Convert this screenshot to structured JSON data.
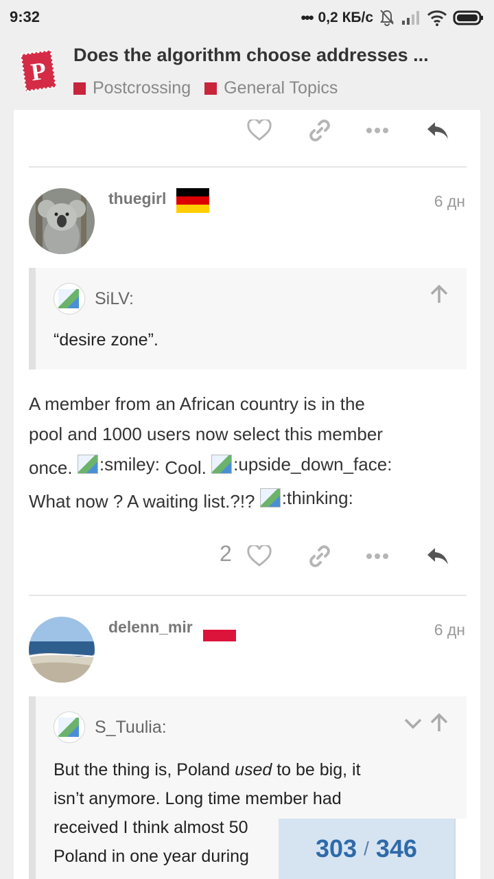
{
  "status": {
    "time": "9:32",
    "network": "0,2 КБ/с"
  },
  "header": {
    "title": "Does the algorithm choose addresses ...",
    "categories": [
      "Postcrossing",
      "General Topics"
    ],
    "category_color": "#c8243c"
  },
  "posts": [
    {
      "username": "thuegirl",
      "flag": "germany",
      "date": "6 дн",
      "quote": {
        "author": "SiLV:",
        "text": "“desire zone”."
      },
      "body": {
        "line1": "A member from an African country is in the",
        "line2": "pool and 1000 users now select this member",
        "line3_a": "once.",
        "emoji1": ":smiley:",
        "line3_b": "Cool.",
        "emoji2": ":upside_down_face:",
        "line4_a": "What now ? A waiting list.?!?",
        "emoji3": ":thinking:"
      },
      "likes": "2"
    },
    {
      "username": "delenn_mir",
      "flag": "poland",
      "date": "6 дн",
      "quote": {
        "author": "S_Tuulia:",
        "line1_a": "But the thing is, Poland ",
        "line1_em": "used",
        "line1_b": " to be big, it",
        "line2": "isn’t anymore. Long time member had",
        "line3": "received I think almost 50",
        "line4": "Poland in one year during"
      }
    }
  ],
  "progress": {
    "current": "303",
    "separator": "/",
    "total": "346"
  },
  "colors": {
    "accent": "#2f6aa8",
    "progress_bg": "#d6e4f2"
  }
}
